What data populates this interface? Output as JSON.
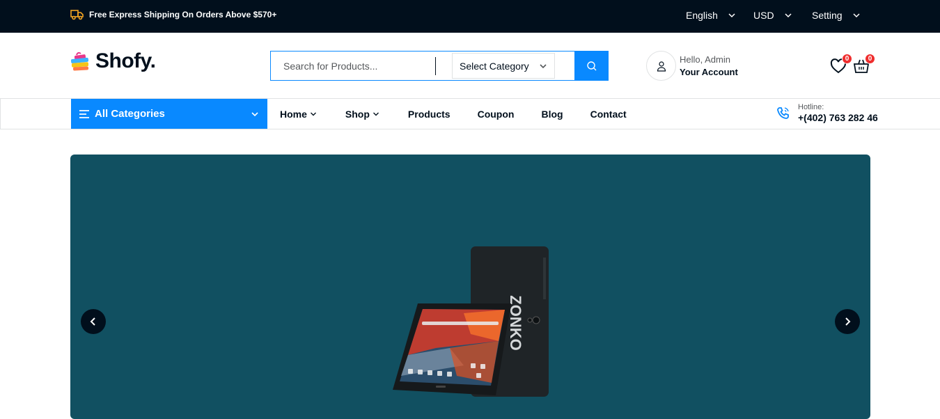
{
  "topbar": {
    "shipping_text": "Free Express Shipping On Orders Above $570+",
    "language": "English",
    "currency": "USD",
    "setting": "Setting"
  },
  "header": {
    "logo_text": "Shofy.",
    "search_placeholder": "Search for Products...",
    "category_select": "Select Category",
    "account_greeting": "Hello, Admin",
    "account_label": "Your Account",
    "wishlist_count": "0",
    "cart_count": "0"
  },
  "nav": {
    "all_categories": "All Categories",
    "items": [
      "Home",
      "Shop",
      "Products",
      "Coupon",
      "Blog",
      "Contact"
    ],
    "hotline_label": "Hotline:",
    "hotline_number": "+(402) 763 282 46"
  },
  "hero": {
    "bg_color": "#115061"
  },
  "colors": {
    "accent": "#0989ff",
    "dark": "#010f1c",
    "badge": "#ef2d2d"
  }
}
